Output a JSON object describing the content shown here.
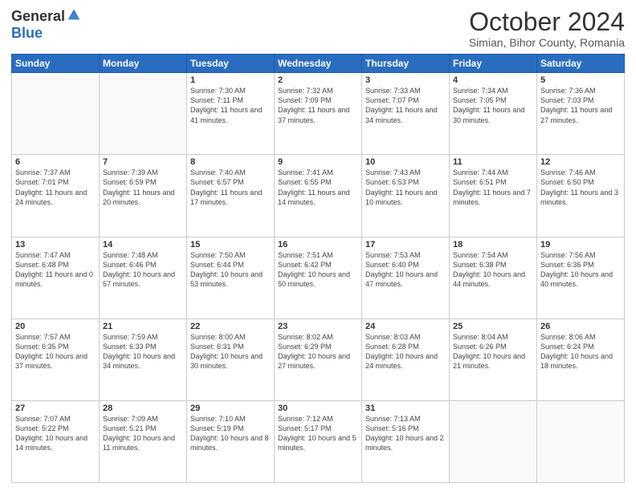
{
  "header": {
    "logo_general": "General",
    "logo_blue": "Blue",
    "month_title": "October 2024",
    "location": "Simian, Bihor County, Romania"
  },
  "weekdays": [
    "Sunday",
    "Monday",
    "Tuesday",
    "Wednesday",
    "Thursday",
    "Friday",
    "Saturday"
  ],
  "weeks": [
    [
      null,
      null,
      {
        "day": 1,
        "sunrise": "7:30 AM",
        "sunset": "7:11 PM",
        "daylight": "11 hours and 41 minutes."
      },
      {
        "day": 2,
        "sunrise": "7:32 AM",
        "sunset": "7:09 PM",
        "daylight": "11 hours and 37 minutes."
      },
      {
        "day": 3,
        "sunrise": "7:33 AM",
        "sunset": "7:07 PM",
        "daylight": "11 hours and 34 minutes."
      },
      {
        "day": 4,
        "sunrise": "7:34 AM",
        "sunset": "7:05 PM",
        "daylight": "11 hours and 30 minutes."
      },
      {
        "day": 5,
        "sunrise": "7:36 AM",
        "sunset": "7:03 PM",
        "daylight": "11 hours and 27 minutes."
      }
    ],
    [
      {
        "day": 6,
        "sunrise": "7:37 AM",
        "sunset": "7:01 PM",
        "daylight": "11 hours and 24 minutes."
      },
      {
        "day": 7,
        "sunrise": "7:39 AM",
        "sunset": "6:59 PM",
        "daylight": "11 hours and 20 minutes."
      },
      {
        "day": 8,
        "sunrise": "7:40 AM",
        "sunset": "6:57 PM",
        "daylight": "11 hours and 17 minutes."
      },
      {
        "day": 9,
        "sunrise": "7:41 AM",
        "sunset": "6:55 PM",
        "daylight": "11 hours and 14 minutes."
      },
      {
        "day": 10,
        "sunrise": "7:43 AM",
        "sunset": "6:53 PM",
        "daylight": "11 hours and 10 minutes."
      },
      {
        "day": 11,
        "sunrise": "7:44 AM",
        "sunset": "6:51 PM",
        "daylight": "11 hours and 7 minutes."
      },
      {
        "day": 12,
        "sunrise": "7:46 AM",
        "sunset": "6:50 PM",
        "daylight": "11 hours and 3 minutes."
      }
    ],
    [
      {
        "day": 13,
        "sunrise": "7:47 AM",
        "sunset": "6:48 PM",
        "daylight": "11 hours and 0 minutes."
      },
      {
        "day": 14,
        "sunrise": "7:48 AM",
        "sunset": "6:46 PM",
        "daylight": "10 hours and 57 minutes."
      },
      {
        "day": 15,
        "sunrise": "7:50 AM",
        "sunset": "6:44 PM",
        "daylight": "10 hours and 53 minutes."
      },
      {
        "day": 16,
        "sunrise": "7:51 AM",
        "sunset": "6:42 PM",
        "daylight": "10 hours and 50 minutes."
      },
      {
        "day": 17,
        "sunrise": "7:53 AM",
        "sunset": "6:40 PM",
        "daylight": "10 hours and 47 minutes."
      },
      {
        "day": 18,
        "sunrise": "7:54 AM",
        "sunset": "6:38 PM",
        "daylight": "10 hours and 44 minutes."
      },
      {
        "day": 19,
        "sunrise": "7:56 AM",
        "sunset": "6:36 PM",
        "daylight": "10 hours and 40 minutes."
      }
    ],
    [
      {
        "day": 20,
        "sunrise": "7:57 AM",
        "sunset": "6:35 PM",
        "daylight": "10 hours and 37 minutes."
      },
      {
        "day": 21,
        "sunrise": "7:59 AM",
        "sunset": "6:33 PM",
        "daylight": "10 hours and 34 minutes."
      },
      {
        "day": 22,
        "sunrise": "8:00 AM",
        "sunset": "6:31 PM",
        "daylight": "10 hours and 30 minutes."
      },
      {
        "day": 23,
        "sunrise": "8:02 AM",
        "sunset": "6:29 PM",
        "daylight": "10 hours and 27 minutes."
      },
      {
        "day": 24,
        "sunrise": "8:03 AM",
        "sunset": "6:28 PM",
        "daylight": "10 hours and 24 minutes."
      },
      {
        "day": 25,
        "sunrise": "8:04 AM",
        "sunset": "6:26 PM",
        "daylight": "10 hours and 21 minutes."
      },
      {
        "day": 26,
        "sunrise": "8:06 AM",
        "sunset": "6:24 PM",
        "daylight": "10 hours and 18 minutes."
      }
    ],
    [
      {
        "day": 27,
        "sunrise": "7:07 AM",
        "sunset": "5:22 PM",
        "daylight": "10 hours and 14 minutes."
      },
      {
        "day": 28,
        "sunrise": "7:09 AM",
        "sunset": "5:21 PM",
        "daylight": "10 hours and 11 minutes."
      },
      {
        "day": 29,
        "sunrise": "7:10 AM",
        "sunset": "5:19 PM",
        "daylight": "10 hours and 8 minutes."
      },
      {
        "day": 30,
        "sunrise": "7:12 AM",
        "sunset": "5:17 PM",
        "daylight": "10 hours and 5 minutes."
      },
      {
        "day": 31,
        "sunrise": "7:13 AM",
        "sunset": "5:16 PM",
        "daylight": "10 hours and 2 minutes."
      },
      null,
      null
    ]
  ]
}
